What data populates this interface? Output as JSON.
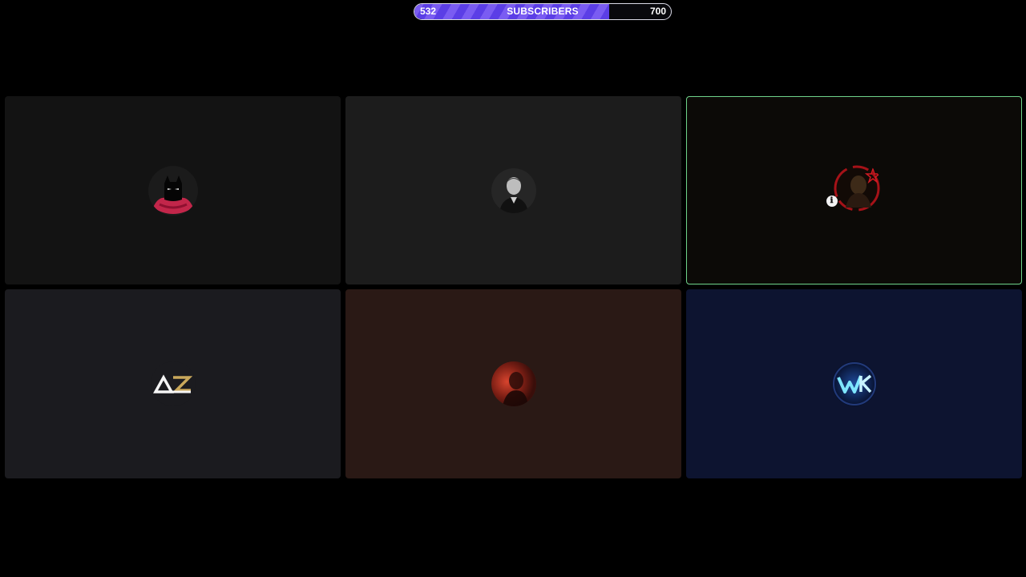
{
  "goal": {
    "current": "532",
    "label": "SUBSCRIBERS",
    "target": "700",
    "progress": 0.76,
    "fill_color": "#5b3ee6",
    "fill_stripe_color": "#7a5cf2"
  },
  "tiles": [
    {
      "id": "tile-1",
      "avatar_icon": "hooded-bat-figure-avatar",
      "background": "#131313",
      "speaking": false
    },
    {
      "id": "tile-2",
      "avatar_icon": "man-portrait-avatar",
      "background": "#1c1c1c",
      "speaking": false
    },
    {
      "id": "tile-3",
      "avatar_icon": "red-circle-figure-avatar",
      "background": "#0c0a07",
      "speaking": true,
      "speaking_color": "#6fd38a",
      "status_icon": "microphone-status-icon"
    },
    {
      "id": "tile-4",
      "avatar_icon": "az-logo-avatar",
      "background": "#1b1b1f",
      "speaking": false
    },
    {
      "id": "tile-5",
      "avatar_icon": "red-portrait-avatar",
      "background": "#2a1915",
      "speaking": false
    },
    {
      "id": "tile-6",
      "avatar_icon": "wk-logo-avatar",
      "background": "#0d1430",
      "speaking": false
    }
  ]
}
